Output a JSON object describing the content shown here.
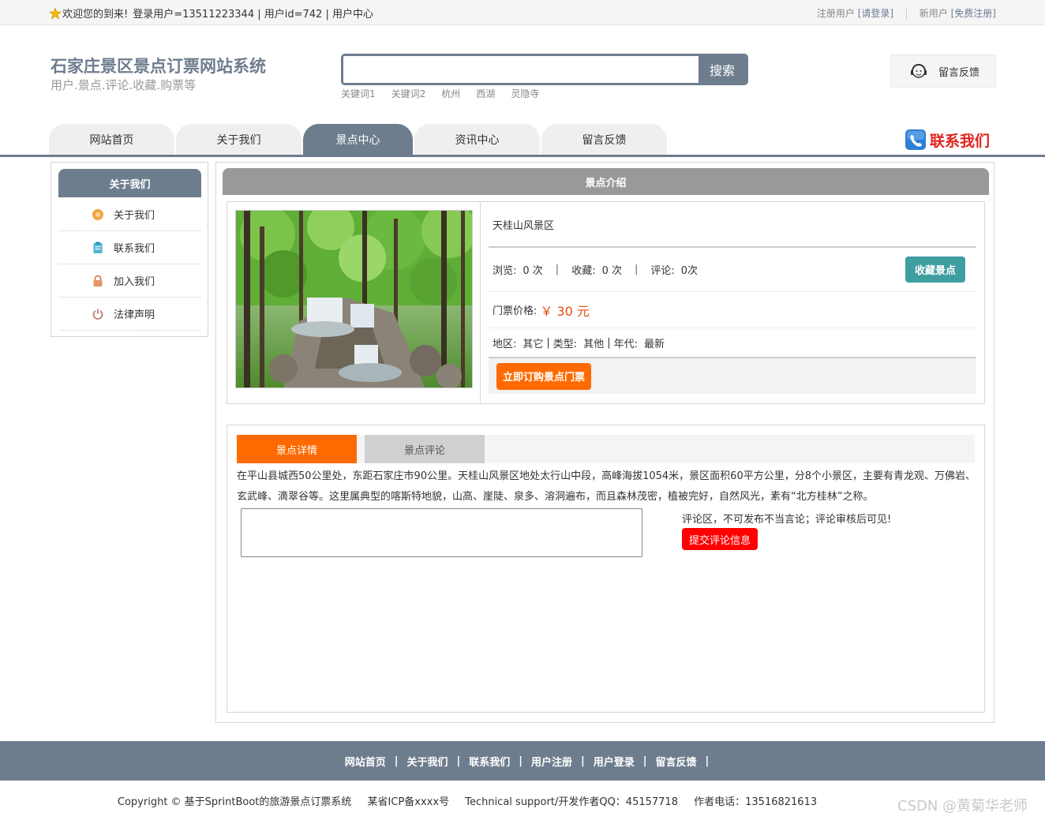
{
  "topbar": {
    "welcome": "欢迎您的到来!",
    "login_info": "登录用户=13511223344 | 用户id=742 | 用户中心",
    "register_user": "注册用户",
    "please_login": "[请登录]",
    "new_user": "新用户",
    "free_register": "[免费注册]"
  },
  "header": {
    "title": "石家庄景区景点订票网站系统",
    "subtitle": "用户.景点.评论.收藏.购票等",
    "search_button": "搜索",
    "search_value": "",
    "keywords": [
      "关键词1",
      "关键词2",
      "杭州",
      "西湖",
      "灵隐寺"
    ],
    "feedback": "留言反馈"
  },
  "nav": {
    "items": [
      "网站首页",
      "关于我们",
      "景点中心",
      "资讯中心",
      "留言反馈"
    ],
    "active_index": 2,
    "contact": "联系我们"
  },
  "sidebar": {
    "title": "关于我们",
    "items": [
      {
        "label": "关于我们",
        "icon": "about-icon"
      },
      {
        "label": "联系我们",
        "icon": "clipboard-icon"
      },
      {
        "label": "加入我们",
        "icon": "lock-icon"
      },
      {
        "label": "法律声明",
        "icon": "power-icon"
      }
    ]
  },
  "main": {
    "title": "景点介绍",
    "spot_name": "天桂山风景区",
    "views_label": "浏览:",
    "views": "0 次",
    "favorites_label": "收藏:",
    "favorites": "0 次",
    "comments_label": "评论:",
    "comments": "0次",
    "favorite_button": "收藏景点",
    "price_label": "门票价格:",
    "price": "￥ 30 元",
    "region_label": "地区:",
    "region": "其它",
    "type_label": "类型:",
    "type": "其他",
    "era_label": "年代:",
    "era": "最新",
    "buy_button": "立即订购景点门票"
  },
  "detail": {
    "tabs": [
      "景点详情",
      "景点评论"
    ],
    "active_tab": 0,
    "description": "在平山县城西50公里处，东距石家庄市90公里。天桂山风景区地处太行山中段，高峰海拔1054米，景区面积60平方公里，分8个小景区，主要有青龙观、万佛岩、玄武峰、滴翠谷等。这里属典型的喀斯特地貌，山高、崖陡、泉多、溶洞遍布，而且森林茂密，植被完好，自然风光，素有“北方桂林”之称。",
    "comment_value": "",
    "comment_note": "评论区，不可发布不当言论；评论审核后可见!",
    "submit_button": "提交评论信息"
  },
  "footer": {
    "links": [
      "网站首页",
      "关于我们",
      "联系我们",
      "用户注册",
      "用户登录",
      "留言反馈"
    ],
    "copyright": "Copyright © 基于SprintBoot的旅游景点订票系统",
    "icp": "某省ICP备xxxx号",
    "support": "Technical support/开发作者QQ：45157718",
    "phone": "作者电话：13516821613",
    "watermark": "CSDN @黄菊华老师"
  },
  "colors": {
    "primary": "#6e7d8e",
    "accent_orange": "#ff6a00",
    "teal": "#3e9ea0",
    "red": "#ff0000",
    "price": "#e44b14"
  }
}
